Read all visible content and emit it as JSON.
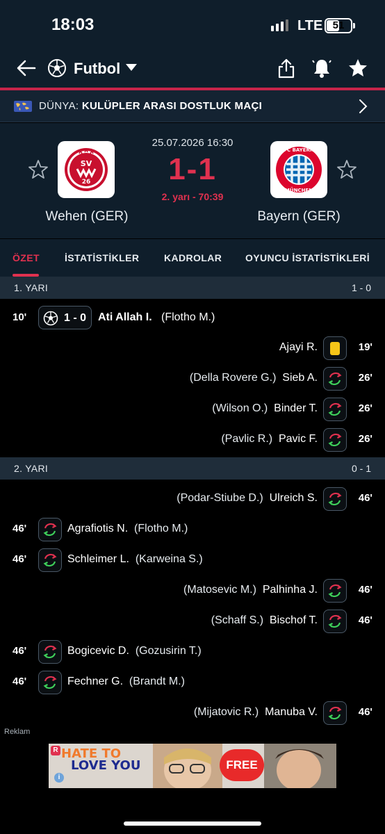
{
  "status_bar": {
    "time": "18:03",
    "network": "LTE",
    "battery": "51",
    "battery_level": 0.51
  },
  "header": {
    "sport": "Futbol",
    "icons": [
      "back-arrow-icon",
      "soccer-ball-icon",
      "caret-down-icon",
      "share-icon",
      "bell-icon",
      "star-icon"
    ]
  },
  "league": {
    "country": "DÜNYA:",
    "name": "KULÜPLER ARASI DOSTLUK MAÇI"
  },
  "match": {
    "datetime": "25.07.2026 16:30",
    "score": "1-1",
    "status": "2. yarı - 70:39",
    "home": {
      "name": "Wehen (GER)"
    },
    "away": {
      "name": "Bayern (GER)"
    }
  },
  "tabs": [
    "ÖZET",
    "İSTATİSTİKLER",
    "KADROLAR",
    "OYUNCU İSTATİSTİKLERİ"
  ],
  "halves": [
    {
      "label": "1. YARI",
      "score": "1 - 0",
      "events": [
        {
          "minute": "10'",
          "side": "home",
          "type": "goal",
          "goal_score": "1 - 0",
          "player": "Ati Allah I.",
          "secondary": "(Flotho M.)"
        },
        {
          "minute": "19'",
          "side": "away",
          "type": "yellow-card",
          "player": "Ajayi R.",
          "secondary": ""
        },
        {
          "minute": "26'",
          "side": "away",
          "type": "substitution",
          "player": "Sieb A.",
          "secondary": "(Della Rovere G.)"
        },
        {
          "minute": "26'",
          "side": "away",
          "type": "substitution",
          "player": "Binder T.",
          "secondary": "(Wilson O.)"
        },
        {
          "minute": "26'",
          "side": "away",
          "type": "substitution",
          "player": "Pavic F.",
          "secondary": "(Pavlic R.)"
        }
      ]
    },
    {
      "label": "2. YARI",
      "score": "0 - 1",
      "events": [
        {
          "minute": "46'",
          "side": "away",
          "type": "substitution",
          "player": "Ulreich S.",
          "secondary": "(Podar-Stiube D.)"
        },
        {
          "minute": "46'",
          "side": "home",
          "type": "substitution",
          "player": "Agrafiotis N.",
          "secondary": "(Flotho M.)"
        },
        {
          "minute": "46'",
          "side": "home",
          "type": "substitution",
          "player": "Schleimer L.",
          "secondary": "(Karweina S.)"
        },
        {
          "minute": "46'",
          "side": "away",
          "type": "substitution",
          "player": "Palhinha J.",
          "secondary": "(Matosevic M.)"
        },
        {
          "minute": "46'",
          "side": "away",
          "type": "substitution",
          "player": "Bischof T.",
          "secondary": "(Schaff S.)"
        },
        {
          "minute": "46'",
          "side": "home",
          "type": "substitution",
          "player": "Bogicevic D.",
          "secondary": "(Gozusirin T.)"
        },
        {
          "minute": "46'",
          "side": "home",
          "type": "substitution",
          "player": "Fechner G.",
          "secondary": "(Brandt M.)"
        },
        {
          "minute": "46'",
          "side": "away",
          "type": "substitution",
          "player": "Manuba V.",
          "secondary": "(Mijatovic R.)"
        }
      ]
    }
  ],
  "ad": {
    "label": "Reklam",
    "title_line1": "HATE TO",
    "title_line2": "LOVE YOU",
    "cta": "FREE"
  },
  "colors": {
    "accent": "#e0314f",
    "header_bg": "#0f1e2b",
    "yellow_card": "#f5c518",
    "sub_in": "#3ecf5a",
    "sub_out": "#e0314f"
  }
}
